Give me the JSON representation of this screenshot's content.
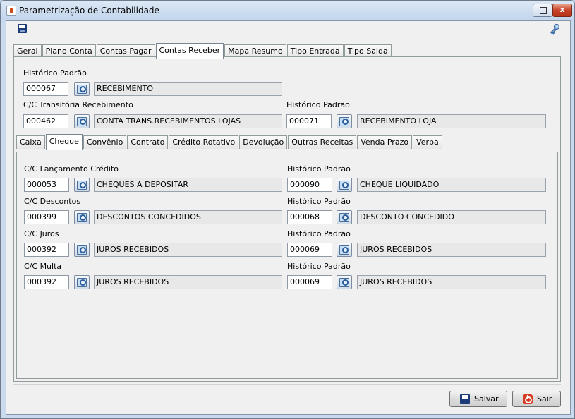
{
  "window": {
    "title": "Parametrização de Contabilidade",
    "close_glyph": "x"
  },
  "outer_tabs": [
    "Geral",
    "Plano Conta",
    "Contas Pagar",
    "Contas Receber",
    "Mapa Resumo",
    "Tipo Entrada",
    "Tipo Saida"
  ],
  "outer_active": "Contas Receber",
  "header": {
    "historico_label": "Histórico Padrão",
    "historico_code": "000067",
    "historico_desc": "RECEBIMENTO",
    "transitoria_label": "C/C Transitória Recebimento",
    "transitoria_code": "000462",
    "transitoria_desc": "CONTA TRANS.RECEBIMENTOS LOJAS",
    "transitoria_hist_label": "Histórico Padrão",
    "transitoria_hist_code": "000071",
    "transitoria_hist_desc": "RECEBIMENTO LOJA"
  },
  "inner_tabs": [
    "Caixa",
    "Cheque",
    "Convênio",
    "Contrato",
    "Crédito Rotativo",
    "Devolução",
    "Outras Receitas",
    "Venda Prazo",
    "Verba"
  ],
  "inner_active": "Cheque",
  "cheque_rows": [
    {
      "label": "C/C Lançamento Crédito",
      "code": "000053",
      "desc": "CHEQUES A DEPOSITAR",
      "hist_label": "Histórico Padrão",
      "hist_code": "000090",
      "hist_desc": "CHEQUE LIQUIDADO"
    },
    {
      "label": "C/C Descontos",
      "code": "000399",
      "desc": "DESCONTOS CONCEDIDOS",
      "hist_label": "Histórico Padrão",
      "hist_code": "000068",
      "hist_desc": "DESCONTO CONCEDIDO"
    },
    {
      "label": "C/C Juros",
      "code": "000392",
      "desc": "JUROS RECEBIDOS",
      "hist_label": "Histórico Padrão",
      "hist_code": "000069",
      "hist_desc": "JUROS RECEBIDOS"
    },
    {
      "label": "C/C Multa",
      "code": "000392",
      "desc": "JUROS RECEBIDOS",
      "hist_label": "Histórico Padrão",
      "hist_code": "000069",
      "hist_desc": "JUROS RECEBIDOS"
    }
  ],
  "buttons": {
    "save": "Salvar",
    "exit": "Sair"
  },
  "icons": {
    "app": "java-cup-icon",
    "toolbar_save": "floppy-disk-icon",
    "toolbar_key": "key-icon",
    "lookup": "magnifier-lookup-icon",
    "save_button": "floppy-disk-icon",
    "exit_button": "power-icon"
  },
  "colors": {
    "title_bar": "#c3d6ec",
    "close_button": "#c7442a",
    "panel": "#f0f0f0",
    "readonly_field": "#e8e8e8"
  }
}
